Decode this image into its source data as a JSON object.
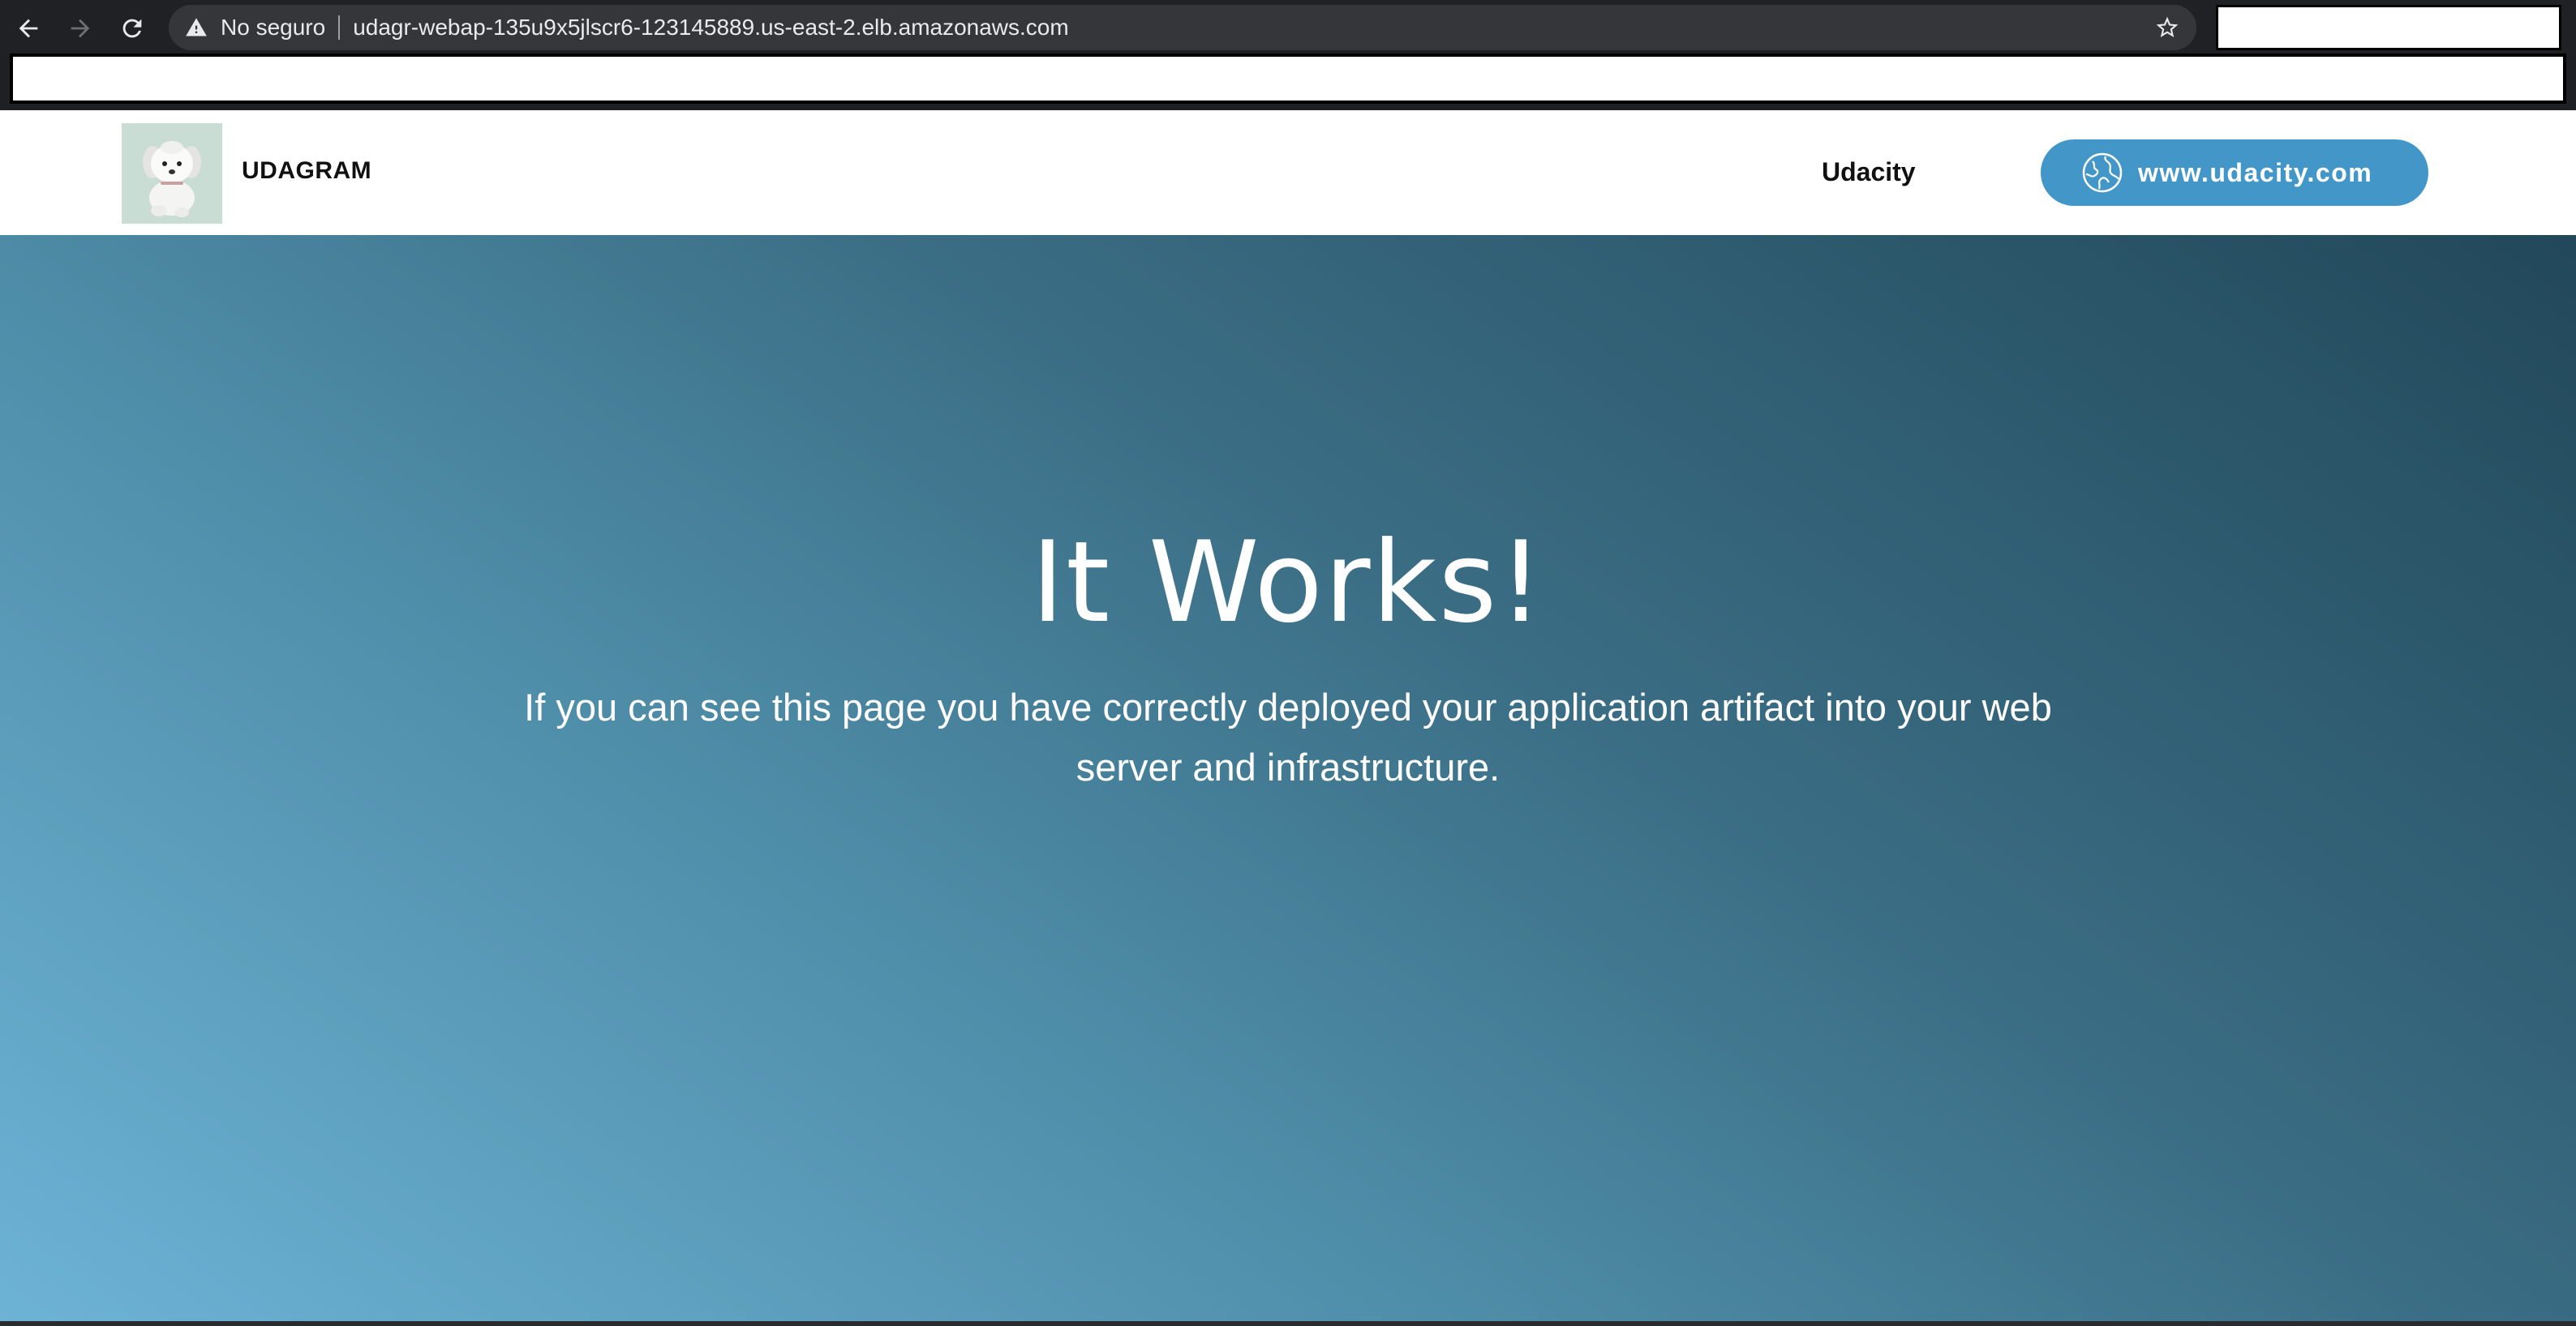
{
  "browser": {
    "security_label": "No seguro",
    "url": "udagr-webap-135u9x5jlscr6-123145889.us-east-2.elb.amazonaws.com",
    "icons": {
      "back": "arrow-left-icon",
      "forward": "arrow-right-icon",
      "reload": "reload-icon",
      "warning": "warning-triangle-icon",
      "bookmark": "star-icon"
    }
  },
  "navbar": {
    "brand": "UDAGRAM",
    "link": "Udacity",
    "cta_label": "www.udacity.com",
    "cta_icon": "globe-icon",
    "cta_color": "#4397c8",
    "logo_icon": "puppy-logo"
  },
  "hero": {
    "title": "It Works!",
    "text": "If you can see this page you have correctly deployed your application artifact into your web server and infrastructure.",
    "gradient_colors": [
      "#6db3d6",
      "#4f8ea9",
      "#3a6d84",
      "#22485a"
    ]
  }
}
